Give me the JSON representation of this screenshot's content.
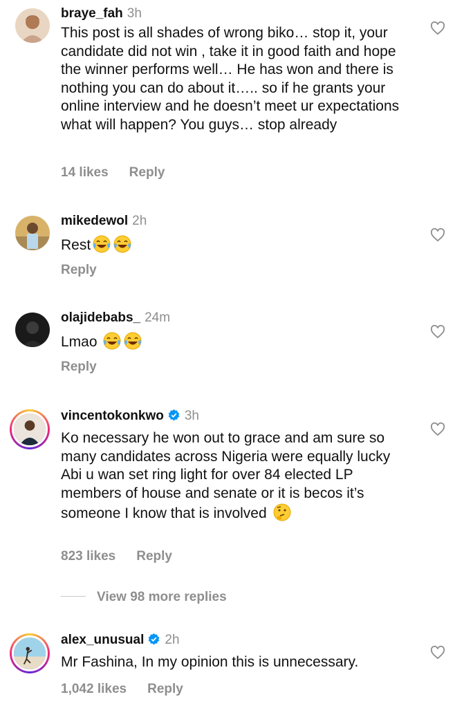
{
  "comments": [
    {
      "username": "braye_fah",
      "time": "3h",
      "text": "This post is all shades of wrong biko… stop it, your candidate did not win , take it in good faith and hope the winner performs well… He has won and there is nothing you can do about it….. so if he grants your online interview and he doesn’t meet ur expectations what will happen? You guys… stop already",
      "likes": "14 likes",
      "reply": "Reply"
    },
    {
      "username": "mikedewol",
      "time": "2h",
      "text": "Rest",
      "emoji": [
        "face-with-tears-of-joy-icon",
        "face-with-tears-of-joy-icon"
      ],
      "reply": "Reply"
    },
    {
      "username": "olajidebabs_",
      "time": "24m",
      "text": "Lmao",
      "emoji": [
        "face-with-tears-of-joy-icon",
        "face-with-tears-of-joy-icon"
      ],
      "reply": "Reply"
    },
    {
      "username": "vincentokonkwo",
      "verified": true,
      "time": "3h",
      "text": "Ko necessary he won out to grace and am sure so many candidates across Nigeria were equally lucky Abi u wan set ring light for over 84 elected LP members of house and senate or it is becos it’s someone I know that is involved",
      "emoji": [
        "thinking-face-icon"
      ],
      "likes": "823 likes",
      "reply": "Reply",
      "view_more": "View 98 more replies"
    },
    {
      "username": "alex_unusual",
      "verified": true,
      "time": "2h",
      "text": "Mr Fashina, In my opinion this is unnecessary.",
      "likes": "1,042 likes",
      "reply": "Reply"
    }
  ],
  "colors": {
    "muted": "#8e8e8e",
    "verified": "#0095f6",
    "text": "#111111"
  }
}
